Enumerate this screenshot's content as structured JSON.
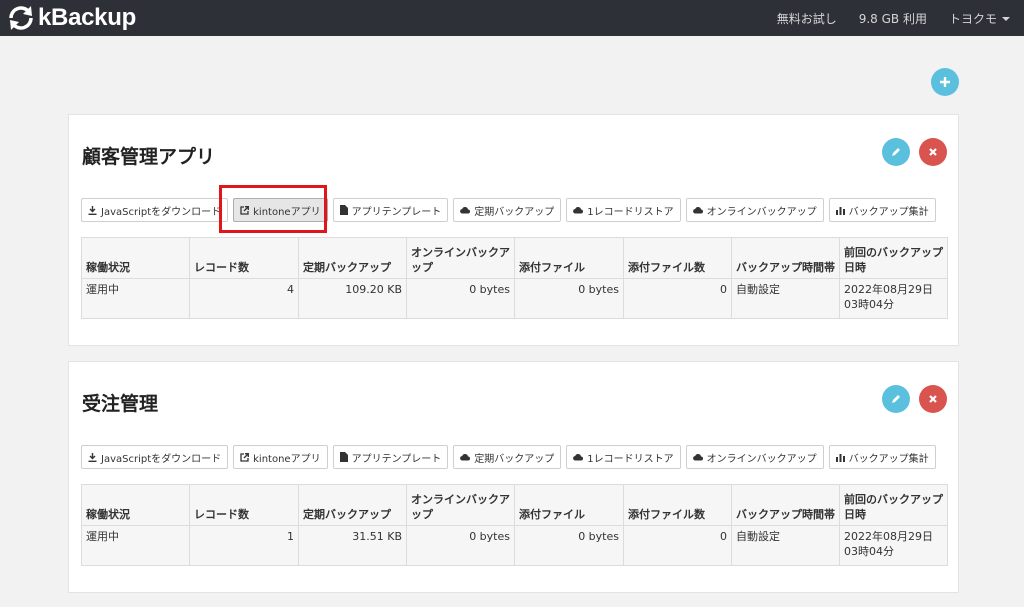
{
  "app": {
    "brand": "kBackup",
    "nav": {
      "trial": "無料お試し",
      "usage": "9.8 GB 利用",
      "user": "トヨクモ"
    }
  },
  "colors": {
    "navbar": "#2e3038",
    "info": "#5bc0de",
    "danger": "#d9534f",
    "highlight": "#e0161b"
  },
  "buttons": {
    "download_js": "JavaScriptをダウンロード",
    "kintone_app": "kintoneアプリ",
    "app_template": "アプリテンプレート",
    "scheduled_backup": "定期バックアップ",
    "single_record_restore": "1レコードリストア",
    "online_backup": "オンラインバックアップ",
    "backup_summary": "バックアップ集計"
  },
  "table_headers": {
    "status": "稼働状況",
    "records": "レコード数",
    "scheduled": "定期バックアップ",
    "online": "オンラインバックアップ",
    "attachments": "添付ファイル",
    "attachment_count": "添付ファイル数",
    "time_slot": "バックアップ時間帯",
    "last_backup": "前回のバックアップ日時"
  },
  "apps": [
    {
      "title": "顧客管理アプリ",
      "status": "運用中",
      "records": "4",
      "scheduled": "109.20 KB",
      "online": "0 bytes",
      "attachments": "0 bytes",
      "attachment_count": "0",
      "time_slot": "自動設定",
      "last_backup": "2022年08月29日03時04分"
    },
    {
      "title": "受注管理",
      "status": "運用中",
      "records": "1",
      "scheduled": "31.51 KB",
      "online": "0 bytes",
      "attachments": "0 bytes",
      "attachment_count": "0",
      "time_slot": "自動設定",
      "last_backup": "2022年08月29日03時04分"
    }
  ]
}
